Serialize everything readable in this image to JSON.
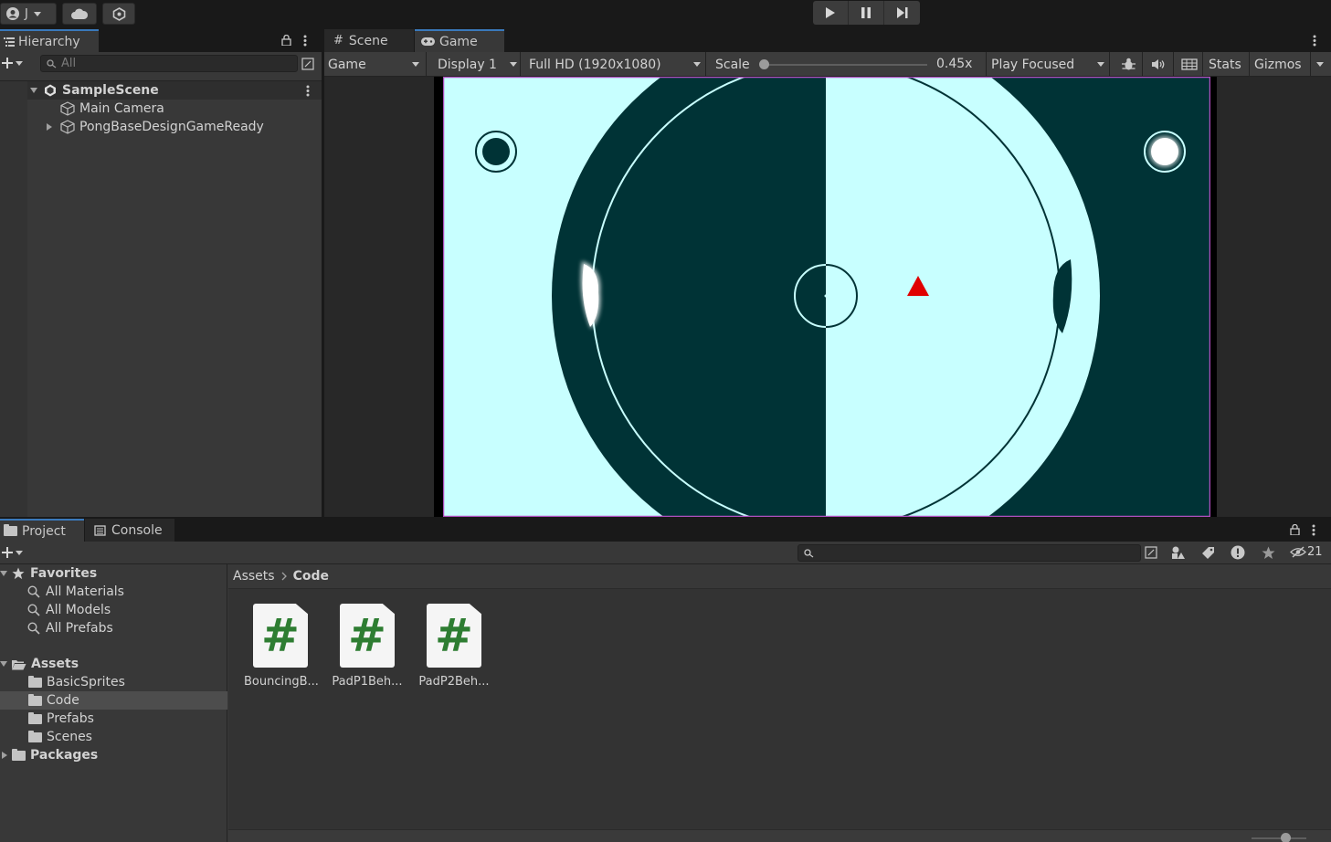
{
  "toolbar": {
    "account_label": "J",
    "play_icon": "play-icon",
    "pause_icon": "pause-icon",
    "step_icon": "step-icon"
  },
  "hierarchy": {
    "tab_label": "Hierarchy",
    "search_placeholder": "All",
    "scene_name": "SampleScene",
    "items": [
      {
        "label": "Main Camera"
      },
      {
        "label": "PongBaseDesignGameReady"
      }
    ]
  },
  "game_panel": {
    "tabs": [
      {
        "label": "Scene"
      },
      {
        "label": "Game"
      }
    ],
    "mode_dropdown": "Game",
    "display_dropdown": "Display 1",
    "resolution_dropdown": "Full HD (1920x1080)",
    "scale_label": "Scale",
    "scale_value": "0.45x",
    "scale_fraction": 0.0,
    "play_mode_dropdown": "Play Focused",
    "stats_label": "Stats",
    "gizmos_label": "Gizmos"
  },
  "game_view": {
    "colors": {
      "light": "#c8ffff",
      "dark": "#003336",
      "frame_border": "#b04fbf",
      "ball": "#e00000"
    }
  },
  "project_panel": {
    "tabs": [
      {
        "label": "Project"
      },
      {
        "label": "Console"
      }
    ],
    "hidden_count": "21",
    "favorites_label": "Favorites",
    "favorites": [
      {
        "label": "All Materials"
      },
      {
        "label": "All Models"
      },
      {
        "label": "All Prefabs"
      }
    ],
    "assets_label": "Assets",
    "asset_folders": [
      {
        "label": "BasicSprites"
      },
      {
        "label": "Code"
      },
      {
        "label": "Prefabs"
      },
      {
        "label": "Scenes"
      }
    ],
    "packages_label": "Packages",
    "breadcrumb_root": "Assets",
    "breadcrumb_current": "Code",
    "files": [
      {
        "name": "BouncingB...",
        "glyph": "#"
      },
      {
        "name": "PadP1Beh...",
        "glyph": "#"
      },
      {
        "name": "PadP2Beh...",
        "glyph": "#"
      }
    ]
  }
}
